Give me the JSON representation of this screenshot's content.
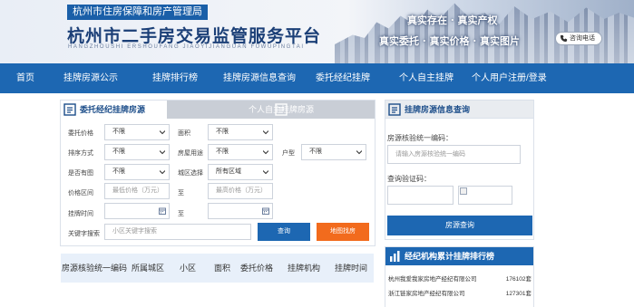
{
  "header": {
    "org_badge": "杭州市住房保障和房产管理局",
    "site_title": "杭州市二手房交易监管服务平台",
    "site_pinyin": "HANGZHOUSHI ERSHOUFANG JIAOYIJIANGUAN FUWUPINGTAI",
    "slogan_line1": "真实存在 · 真实产权",
    "slogan_line2": "真实委托 · 真实价格 · 真实图片",
    "consult_label": "咨询电话"
  },
  "nav": {
    "items": [
      "首页",
      "挂牌房源公示",
      "挂牌排行榜",
      "挂牌房源信息查询",
      "委托经纪挂牌",
      "个人自主挂牌",
      "个人用户注册/登录"
    ]
  },
  "search_panel": {
    "tabs": [
      "委托经纪挂牌房源",
      "个人自主挂牌房源"
    ],
    "labels": {
      "price": "委托价格",
      "area": "面积",
      "sort": "排序方式",
      "usage": "房屋用途",
      "layout": "户型",
      "has_image": "是否有图",
      "district": "城区选择",
      "price_range": "价格区间",
      "to1": "至",
      "listing_time": "挂牌时间",
      "to2": "至",
      "keyword": "关键字搜索"
    },
    "selects": {
      "price": "不限",
      "area": "不限",
      "sort": "不限",
      "usage": "不限",
      "layout": "不限",
      "has_image": "不限",
      "district": "所有区域"
    },
    "placeholders": {
      "min_price": "最低价格（万元）",
      "max_price": "最高价格（万元）",
      "keyword": "小区关键字搜索"
    },
    "buttons": {
      "search": "查询",
      "map_search": "地图找房"
    }
  },
  "results_table": {
    "columns": [
      "房源核验统一编码",
      "所属城区",
      "小区",
      "面积",
      "委托价格",
      "挂牌机构",
      "挂牌时间"
    ]
  },
  "info_query": {
    "title": "挂牌房源信息查询",
    "code_label": "房源核验统一编码：",
    "code_placeholder": "请输入房源核验统一编码",
    "verify_label": "查询验证码：",
    "button": "房源查询"
  },
  "ranking": {
    "title": "经纪机构累计挂牌排行榜",
    "rows": [
      {
        "name": "杭州我爱我家房地产经纪有限公司",
        "count": "176102套"
      },
      {
        "name": "浙江链家房地产经纪有限公司",
        "count": "127301套"
      }
    ]
  },
  "colors": {
    "nav_blue": "#1d67b2",
    "search_button": "#1d67b2",
    "map_button": "#f26b1d",
    "badge_blue": "#1a5fa8"
  },
  "icons": [
    "phone-icon",
    "house-icon",
    "calendar-icon",
    "chevron-down-icon",
    "bar-chart-icon"
  ]
}
